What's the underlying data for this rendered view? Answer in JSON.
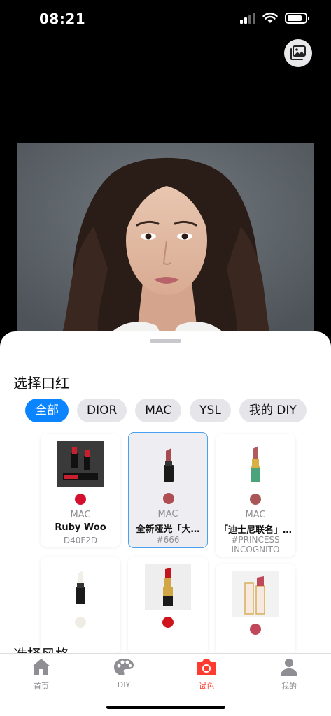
{
  "status": {
    "time": "08:21",
    "battery_level": 0.85
  },
  "icons": {
    "gallery": "gallery-icon",
    "home": "home-icon",
    "diy": "palette-icon",
    "tryon": "camera-icon",
    "me": "person-icon"
  },
  "sheet": {
    "title": "选择口红",
    "next_title": "选择风格"
  },
  "filters": [
    {
      "label": "全部",
      "active": true
    },
    {
      "label": "DIOR",
      "active": false
    },
    {
      "label": "MAC",
      "active": false
    },
    {
      "label": "YSL",
      "active": false
    },
    {
      "label": "我的 DIY",
      "active": false
    }
  ],
  "lipsticks": [
    {
      "brand": "MAC",
      "name": "Ruby Woo",
      "code": "D40F2D",
      "color": "#d40f2d",
      "selected": false
    },
    {
      "brand": "MAC",
      "name": "全新哑光「大…",
      "code": "#666",
      "color": "#b04d52",
      "selected": true
    },
    {
      "brand": "MAC",
      "name": "「迪士尼联名」…",
      "code": "#PRINCESS INCOGNITO",
      "color": "#a85657",
      "selected": false
    },
    {
      "brand": "",
      "name": "",
      "code": "",
      "color": "#eeece4",
      "selected": false
    },
    {
      "brand": "",
      "name": "",
      "code": "",
      "color": "#d0141e",
      "selected": false
    },
    {
      "brand": "",
      "name": "",
      "code": "",
      "color": "#c0485a",
      "selected": false
    }
  ],
  "tabs": [
    {
      "label": "首页",
      "active": false
    },
    {
      "label": "DIY",
      "active": false
    },
    {
      "label": "试色",
      "active": true
    },
    {
      "label": "我的",
      "active": false
    }
  ],
  "colors": {
    "accent": "#0a84ff",
    "active_tab": "#ff3b30"
  }
}
